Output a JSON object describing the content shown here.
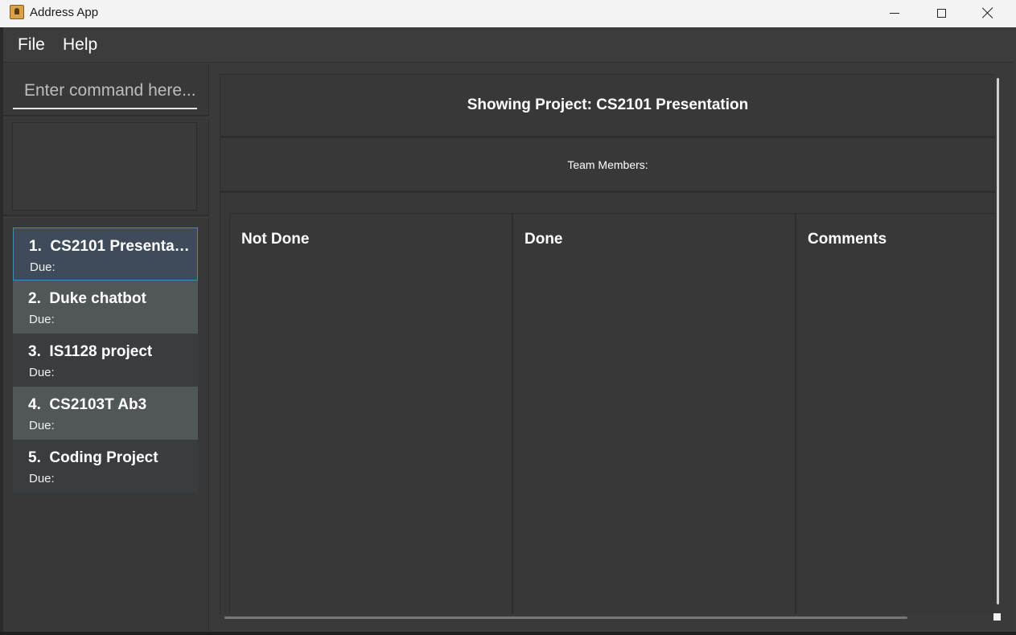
{
  "window": {
    "title": "Address App",
    "icon": "address-book-icon",
    "controls": {
      "minimize": "minimize-icon",
      "maximize": "maximize-icon",
      "close": "close-icon"
    }
  },
  "menu": {
    "file": "File",
    "help": "Help"
  },
  "command": {
    "placeholder": "Enter command here...",
    "value": ""
  },
  "result_display": {
    "text": ""
  },
  "projects": [
    {
      "index": "1.",
      "name": "CS2101 Presentation",
      "due": "Due:",
      "selected": true
    },
    {
      "index": "2.",
      "name": "Duke chatbot",
      "due": "Due:",
      "selected": false
    },
    {
      "index": "3.",
      "name": "IS1128 project",
      "due": "Due:",
      "selected": false
    },
    {
      "index": "4.",
      "name": "CS2103T Ab3",
      "due": "Due:",
      "selected": false
    },
    {
      "index": "5.",
      "name": "Coding Project",
      "due": "Due:",
      "selected": false
    }
  ],
  "project_view": {
    "header": "Showing Project: CS2101 Presentation",
    "team_members_label": "Team Members:",
    "columns": {
      "not_done": "Not Done",
      "done": "Done",
      "comments": "Comments"
    }
  },
  "colors": {
    "background": "#3c3c3c",
    "selected_card": "#3f4b5a",
    "selected_border": "#3b8fb5",
    "alt_card": "#515658"
  }
}
